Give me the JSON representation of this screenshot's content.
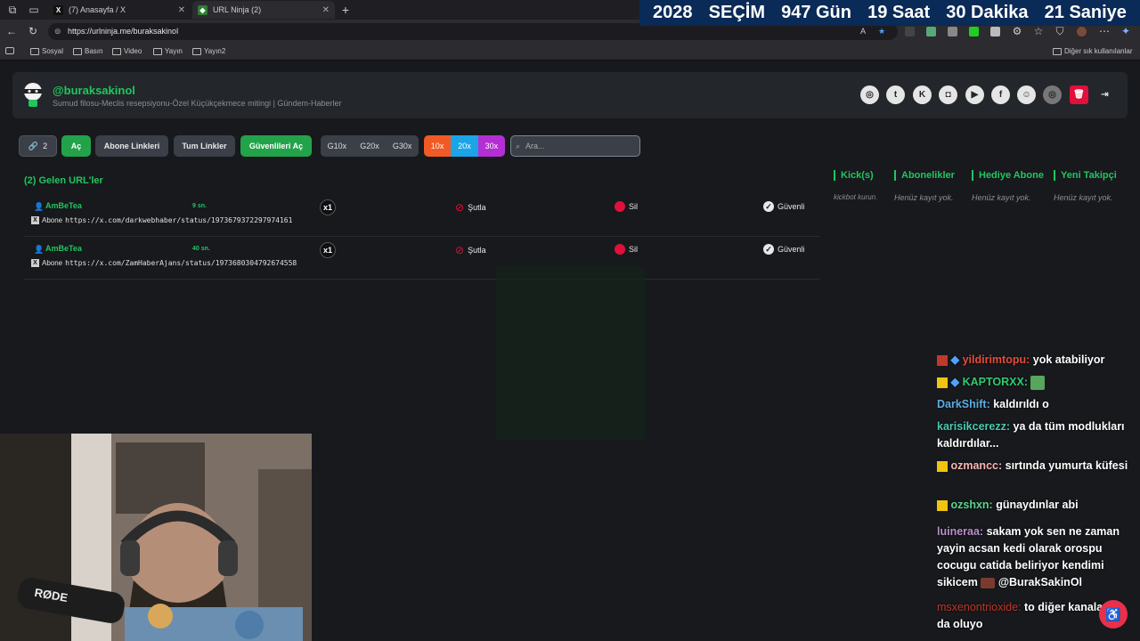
{
  "browser": {
    "tabs": [
      {
        "label": "(7) Anasayfa / X"
      },
      {
        "label": "URL Ninja (2)"
      }
    ],
    "url": "https://urlninja.me/buraksakinol",
    "bookmarks": [
      "Sosyal",
      "Basın",
      "Video",
      "Yayın",
      "Yayın2"
    ],
    "other_bookmarks": "Diğer sık kullanılanlar"
  },
  "countdown": {
    "year": "2028",
    "label": "SEÇİM",
    "days": "947 Gün",
    "hours": "19 Saat",
    "minutes": "30 Dakika",
    "seconds": "21 Saniye"
  },
  "header": {
    "username": "@buraksakinol",
    "subtitle": "Sumud filosu-Meclis resepsiyonu-Özel Küçükçekmece mitingi | Gündem-Haberler",
    "social_icons": [
      "dribbble-icon",
      "twitter-icon",
      "kick-icon",
      "instagram-icon",
      "youtube-icon",
      "facebook-icon",
      "discord-icon",
      "dribbble-icon",
      "trash-icon",
      "logout-icon"
    ]
  },
  "toolbar": {
    "link_count": "2",
    "open": "Aç",
    "subscriber_links": "Abone Linkleri",
    "all_links": "Tum Linkler",
    "open_trusted": "Güvenlileri Aç",
    "g_buttons": [
      "G10x",
      "G20x",
      "G30x"
    ],
    "x_buttons": [
      "10x",
      "20x",
      "30x"
    ],
    "x_colors": [
      "#f15a24",
      "#1ba4e6",
      "#b42fd3"
    ],
    "search_placeholder": "Ara..."
  },
  "list": {
    "title": "(2) Gelen URL'ler",
    "rows": [
      {
        "user": "AmBeTea",
        "time": "9 sn.",
        "multiplier": "x1",
        "skip": "Şutla",
        "delete": "Sil",
        "trusted": "Güvenli",
        "tag": "Abone",
        "url": "https://x.com/darkwebhaber/status/1973679372297974161"
      },
      {
        "user": "AmBeTea",
        "time": "40 sn.",
        "multiplier": "x1",
        "skip": "Şutla",
        "delete": "Sil",
        "trusted": "Güvenli",
        "tag": "Abone",
        "url": "https://x.com/ZamHaberAjans/status/1973680304792674558"
      }
    ]
  },
  "right_columns": [
    {
      "title": "Kick(s)",
      "empty": "kickbot kurun."
    },
    {
      "title": "Abonelikler",
      "empty": "Henüz kayıt yok."
    },
    {
      "title": "Hediye Abone",
      "empty": "Henüz kayıt yok."
    },
    {
      "title": "Yeni Takipçi",
      "empty": "Henüz kayıt yok."
    }
  ],
  "chat": [
    {
      "user": "yildirimtopu:",
      "text": "yok atabiliyor",
      "color": "#e74c3c"
    },
    {
      "user": "KAPTORXX:",
      "text": "",
      "color": "#2ecc71"
    },
    {
      "user": "DarkShift:",
      "text": "kaldırıldı o",
      "color": "#5dade2"
    },
    {
      "user": "karisikcerezz:",
      "text": "ya da tüm modlukları kaldırdılar...",
      "color": "#48c9b0"
    },
    {
      "user": "ozmancc:",
      "text": "sırtında yumurta küfesi",
      "color": "#f5b7b1"
    },
    {
      "user": "ozshxn:",
      "text": "günaydınlar abi",
      "color": "#58d68d"
    },
    {
      "user": "luineraa:",
      "text": "sakam yok sen ne zaman yayin acsan kedi olarak orospu cocugu catida beliriyor kendimi sikicem",
      "color": "#bb8fce"
    },
    {
      "user": "@BurakSakinOl",
      "text": "",
      "color": "#ffffff"
    },
    {
      "user": "msxenontrioxide:",
      "text": "to diğer kanalarda da oluyo",
      "color": "#c0392b"
    }
  ]
}
